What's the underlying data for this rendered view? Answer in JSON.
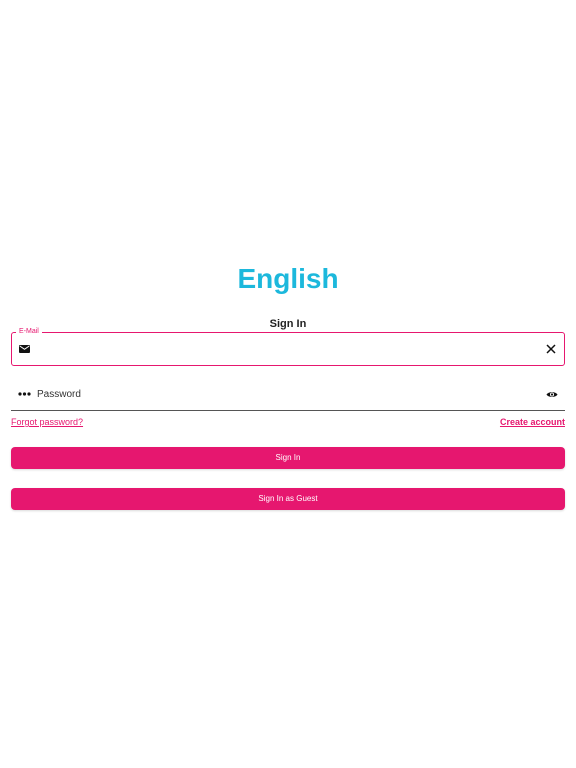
{
  "colors": {
    "title": "#1cb8dc",
    "accent": "#e6176f",
    "icon": "#111111"
  },
  "app_title": "English",
  "form": {
    "heading": "Sign In",
    "email": {
      "label": "E-Mail",
      "value": "",
      "leading_icon": "email-icon",
      "trailing_icon": "clear-icon"
    },
    "password": {
      "placeholder": "Password",
      "value": "",
      "leading_icon": "password-dots-icon",
      "trailing_icon": "visibility-eye-icon"
    },
    "forgot_password": "Forgot password?",
    "create_account": "Create account",
    "sign_in_button": "Sign In",
    "guest_button": "Sign In as Guest"
  }
}
